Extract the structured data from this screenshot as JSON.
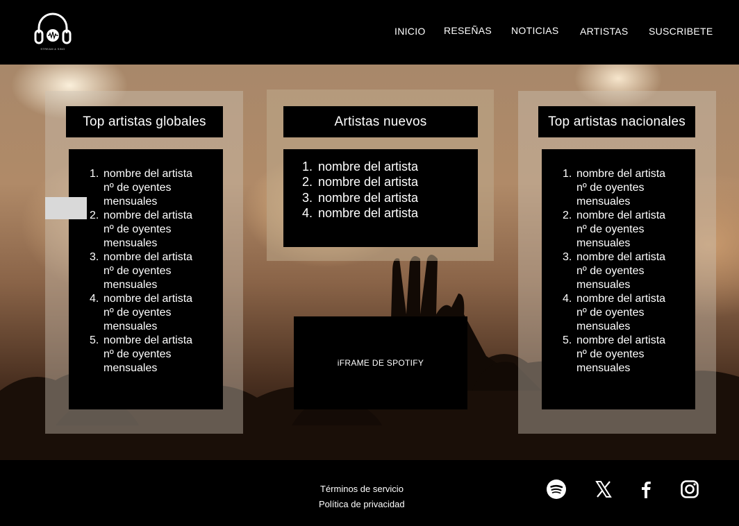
{
  "header": {
    "logo_caption": "STREAM & SING",
    "nav": [
      "INICIO",
      "RESEÑAS",
      "NOTICIAS",
      "ARTISTAS",
      "SUSCRIBETE"
    ]
  },
  "panels": {
    "global": {
      "title": "Top artistas globales",
      "items": [
        {
          "name": "nombre del artista",
          "listeners": "nº de oyentes",
          "unit": "mensuales"
        },
        {
          "name": "nombre del artista",
          "listeners": "nº de oyentes",
          "unit": "mensuales"
        },
        {
          "name": "nombre del artista",
          "listeners": "nº de oyentes",
          "unit": "mensuales"
        },
        {
          "name": "nombre del artista",
          "listeners": "nº de oyentes",
          "unit": "mensuales"
        },
        {
          "name": "nombre del artista",
          "listeners": "nº de oyentes",
          "unit": "mensuales"
        }
      ]
    },
    "new": {
      "title": "Artistas nuevos",
      "items": [
        "nombre del artista",
        "nombre del artista",
        "nombre del artista",
        "nombre del artista"
      ]
    },
    "national": {
      "title": "Top artistas nacionales",
      "items": [
        {
          "name": "nombre del artista",
          "listeners": "nº de oyentes",
          "unit": "mensuales"
        },
        {
          "name": "nombre del artista",
          "listeners": "nº de oyentes",
          "unit": "mensuales"
        },
        {
          "name": "nombre del artista",
          "listeners": "nº de oyentes",
          "unit": "mensuales"
        },
        {
          "name": "nombre del artista",
          "listeners": "nº de oyentes",
          "unit": "mensuales"
        },
        {
          "name": "nombre del artista",
          "listeners": "nº de oyentes",
          "unit": "mensuales"
        }
      ]
    }
  },
  "spotify_embed_label": "iFRAME DE SPOTIFY",
  "footer": {
    "terms": "Términos de servicio",
    "privacy": "Política de privacidad",
    "social": [
      "spotify-icon",
      "x-icon",
      "facebook-icon",
      "instagram-icon"
    ]
  }
}
